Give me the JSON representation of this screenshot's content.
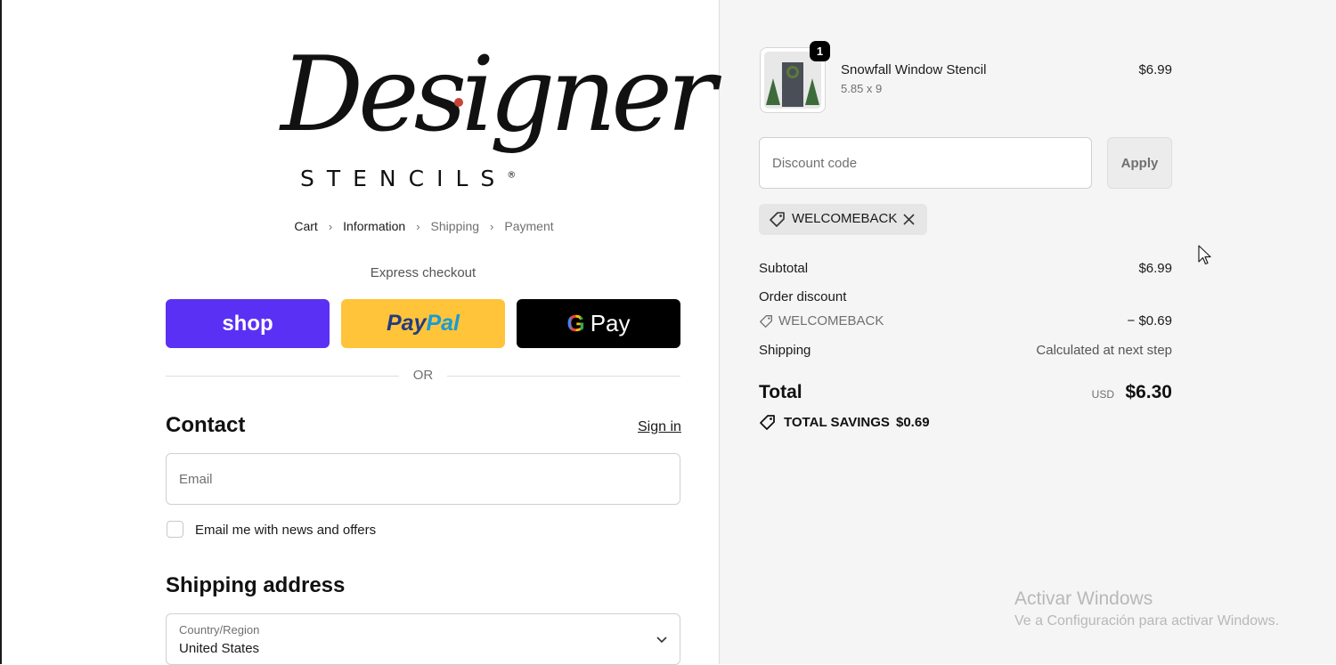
{
  "brand": {
    "script": "Designer",
    "sub": "STENCILS",
    "trademark": "®"
  },
  "breadcrumb": {
    "items": [
      {
        "label": "Cart",
        "state": "link"
      },
      {
        "label": "Information",
        "state": "current"
      },
      {
        "label": "Shipping",
        "state": "upcoming"
      },
      {
        "label": "Payment",
        "state": "upcoming"
      }
    ]
  },
  "express": {
    "label": "Express checkout",
    "shop_label": "shop",
    "paypal_part1": "Pay",
    "paypal_part2": "Pal",
    "gpay_g": "G",
    "gpay_label": "Pay",
    "colors": {
      "shop": "#5a31f4",
      "paypal": "#ffc439",
      "gpay": "#000000"
    }
  },
  "or_text": "OR",
  "contact": {
    "title": "Contact",
    "signin": "Sign in",
    "email_placeholder": "Email",
    "newsletter_label": "Email me with news and offers",
    "newsletter_checked": false
  },
  "shipping": {
    "title": "Shipping address",
    "country_label": "Country/Region",
    "country_value": "United States"
  },
  "cart": {
    "item": {
      "name": "Snowfall Window Stencil",
      "variant": "5.85 x 9",
      "price": "$6.99",
      "quantity": "1"
    },
    "discount_placeholder": "Discount code",
    "apply_label": "Apply",
    "applied_code": "WELCOMEBACK",
    "summary": {
      "subtotal_label": "Subtotal",
      "subtotal_value": "$6.99",
      "order_discount_label": "Order discount",
      "discount_code": "WELCOMEBACK",
      "discount_value": "− $0.69",
      "shipping_label": "Shipping",
      "shipping_value": "Calculated at next step",
      "total_label": "Total",
      "total_currency": "USD",
      "total_value": "$6.30",
      "savings_label": "TOTAL SAVINGS",
      "savings_value": "$0.69"
    }
  },
  "watermark": {
    "title": "Activar Windows",
    "subtitle": "Ve a Configuración para activar Windows."
  }
}
